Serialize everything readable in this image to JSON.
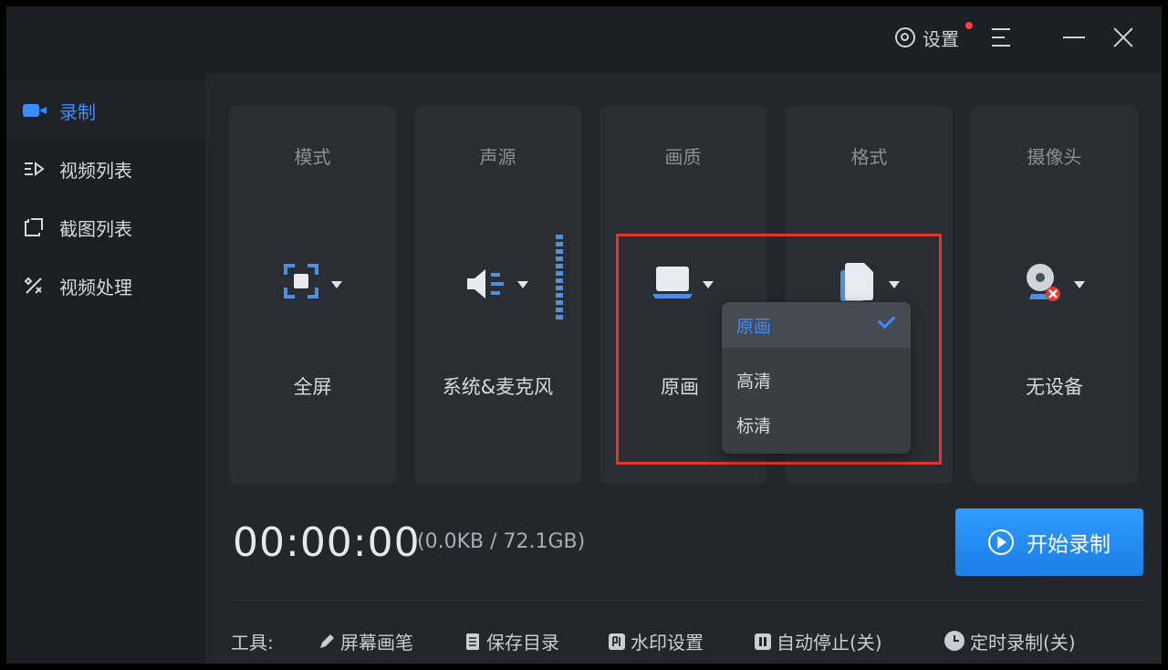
{
  "titlebar": {
    "settings_label": "设置"
  },
  "sidebar": {
    "items": [
      {
        "label": "录制"
      },
      {
        "label": "视频列表"
      },
      {
        "label": "截图列表"
      },
      {
        "label": "视频处理"
      }
    ]
  },
  "cards": [
    {
      "header": "模式",
      "value": "全屏",
      "icon": "fullscreen-icon"
    },
    {
      "header": "声源",
      "value": "系统&麦克风",
      "icon": "speaker-icon"
    },
    {
      "header": "画质",
      "value": "原画",
      "icon": "monitor-icon"
    },
    {
      "header": "格式",
      "value": "",
      "icon": "file-icon"
    },
    {
      "header": "摄像头",
      "value": "无设备",
      "icon": "webcam-icon"
    }
  ],
  "quality_dropdown": {
    "options": [
      "原画",
      "高清",
      "标清"
    ],
    "selected": "原画"
  },
  "status": {
    "timer": "00:00:00",
    "size": "(0.0KB / 72.1GB)"
  },
  "start_button": {
    "label": "开始录制"
  },
  "tools": {
    "label": "工具:",
    "items": [
      "屏幕画笔",
      "保存目录",
      "水印设置",
      "自动停止(关)",
      "定时录制(关)"
    ]
  },
  "colors": {
    "accent": "#3a8dff",
    "highlight": "#e3342f",
    "background": "#1e2126"
  }
}
